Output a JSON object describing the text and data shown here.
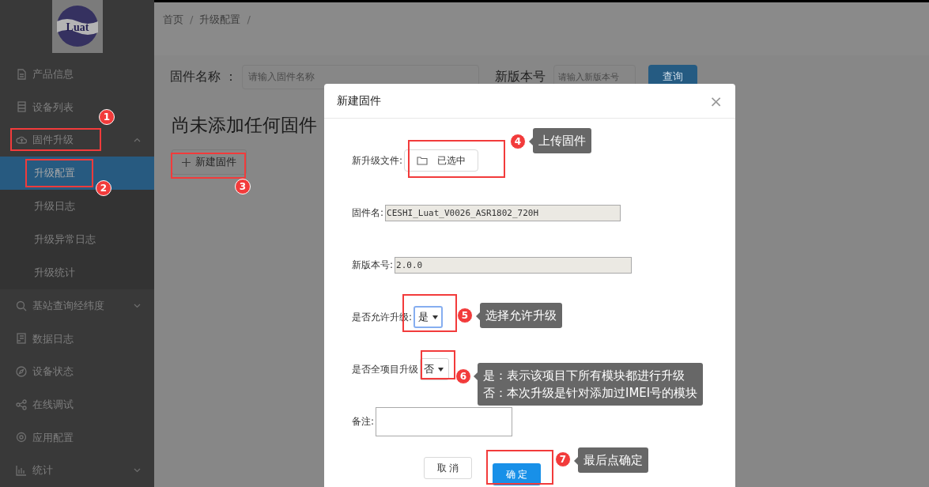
{
  "logo": {
    "text": "Luat"
  },
  "sidebar": {
    "items": [
      {
        "label": "产品信息",
        "kind": "link"
      },
      {
        "label": "设备列表",
        "kind": "link"
      },
      {
        "label": "固件升级",
        "kind": "group",
        "expanded": true,
        "children": [
          {
            "label": "升级配置",
            "selected": true
          },
          {
            "label": "升级日志",
            "selected": false
          },
          {
            "label": "升级异常日志",
            "selected": false
          },
          {
            "label": "升级统计",
            "selected": false
          }
        ]
      },
      {
        "label": "基站查询经纬度",
        "kind": "group",
        "expanded": false
      },
      {
        "label": "数据日志",
        "kind": "link"
      },
      {
        "label": "设备状态",
        "kind": "link"
      },
      {
        "label": "在线调试",
        "kind": "link"
      },
      {
        "label": "应用配置",
        "kind": "link"
      },
      {
        "label": "统计",
        "kind": "group",
        "expanded": false
      }
    ]
  },
  "breadcrumb": [
    {
      "label": "首页",
      "separator": "/"
    },
    {
      "label": "升级配置",
      "separator": "/"
    }
  ],
  "filters": [
    {
      "label": "固件名称 ：",
      "placeholder": "请输入固件名称"
    },
    {
      "label": "新版本号",
      "placeholder": "请输入新版本号"
    }
  ],
  "search_button": "查询",
  "empty_heading": "尚未添加任何固件",
  "new_button": "新建固件",
  "modal": {
    "title": "新建固件",
    "close": "×",
    "fields": [
      {
        "kind": "file",
        "label": "新升级文件:",
        "value": "已选中"
      },
      {
        "kind": "text",
        "label": "固件名:",
        "value": "CESHI_Luat_V0026_ASR1802_720H"
      },
      {
        "kind": "text",
        "label": "新版本号:",
        "value": "2.0.0"
      },
      {
        "kind": "select",
        "label": "是否允许升级:",
        "value": "是",
        "focused": true
      },
      {
        "kind": "select",
        "label": "是否全项目升级",
        "value": "否",
        "focused": false
      },
      {
        "kind": "textarea",
        "label": "备注:"
      }
    ],
    "buttons": [
      {
        "label": "取 消",
        "kind": "default"
      },
      {
        "label": "确 定",
        "kind": "primary"
      }
    ]
  },
  "annotations": [
    {
      "number": "1"
    },
    {
      "number": "2"
    },
    {
      "number": "3"
    },
    {
      "number": "4",
      "callout": [
        "上传固件"
      ]
    },
    {
      "number": "5",
      "callout": [
        "选择允许升级"
      ]
    },
    {
      "number": "6",
      "callout": [
        "是：表示该项目下所有模块都进行升级",
        "否：本次升级是针对添加过IMEI号的模块"
      ]
    },
    {
      "number": "7",
      "callout": [
        "最后点确定"
      ]
    }
  ]
}
